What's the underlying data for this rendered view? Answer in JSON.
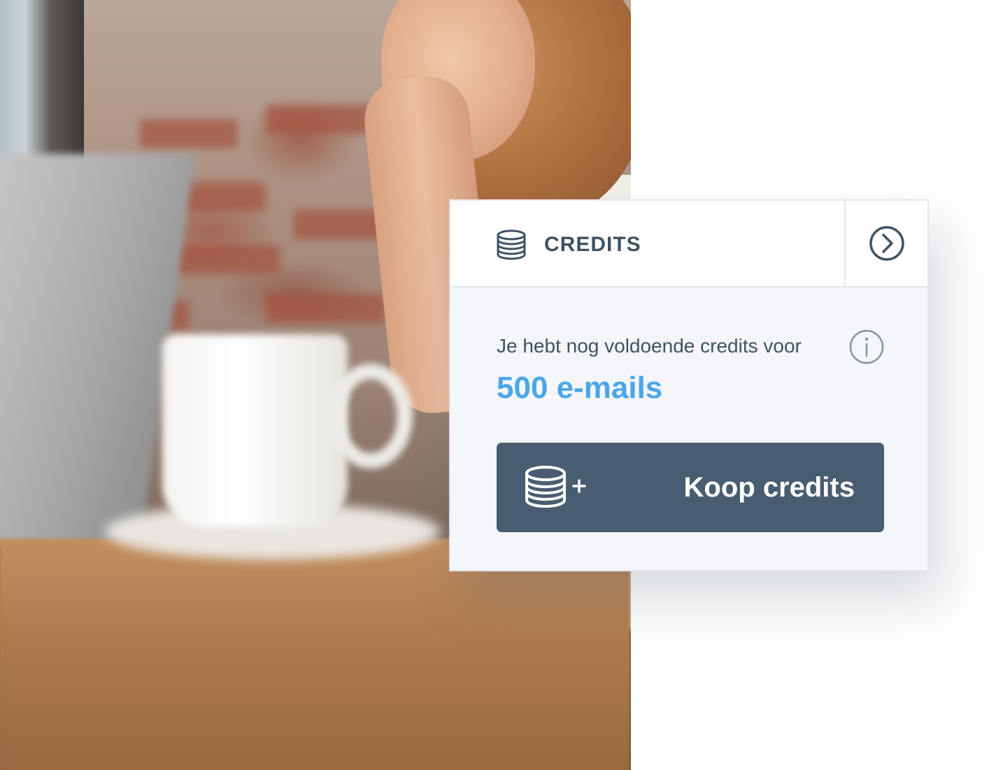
{
  "widget": {
    "header": {
      "icon": "coins-stack-icon",
      "title": "CREDITS",
      "next_icon": "chevron-right-circle-icon"
    },
    "body": {
      "description": "Je hebt nog voldoende credits voor",
      "info_icon": "info-icon",
      "amount": "500 e-mails"
    },
    "buy_button": {
      "icon": "coins-add-icon",
      "label": "Koop credits"
    }
  },
  "colors": {
    "header_text": "#3f5264",
    "accent": "#4aa6e8",
    "button_bg": "#485d70",
    "card_bg": "#f4f6f9"
  }
}
